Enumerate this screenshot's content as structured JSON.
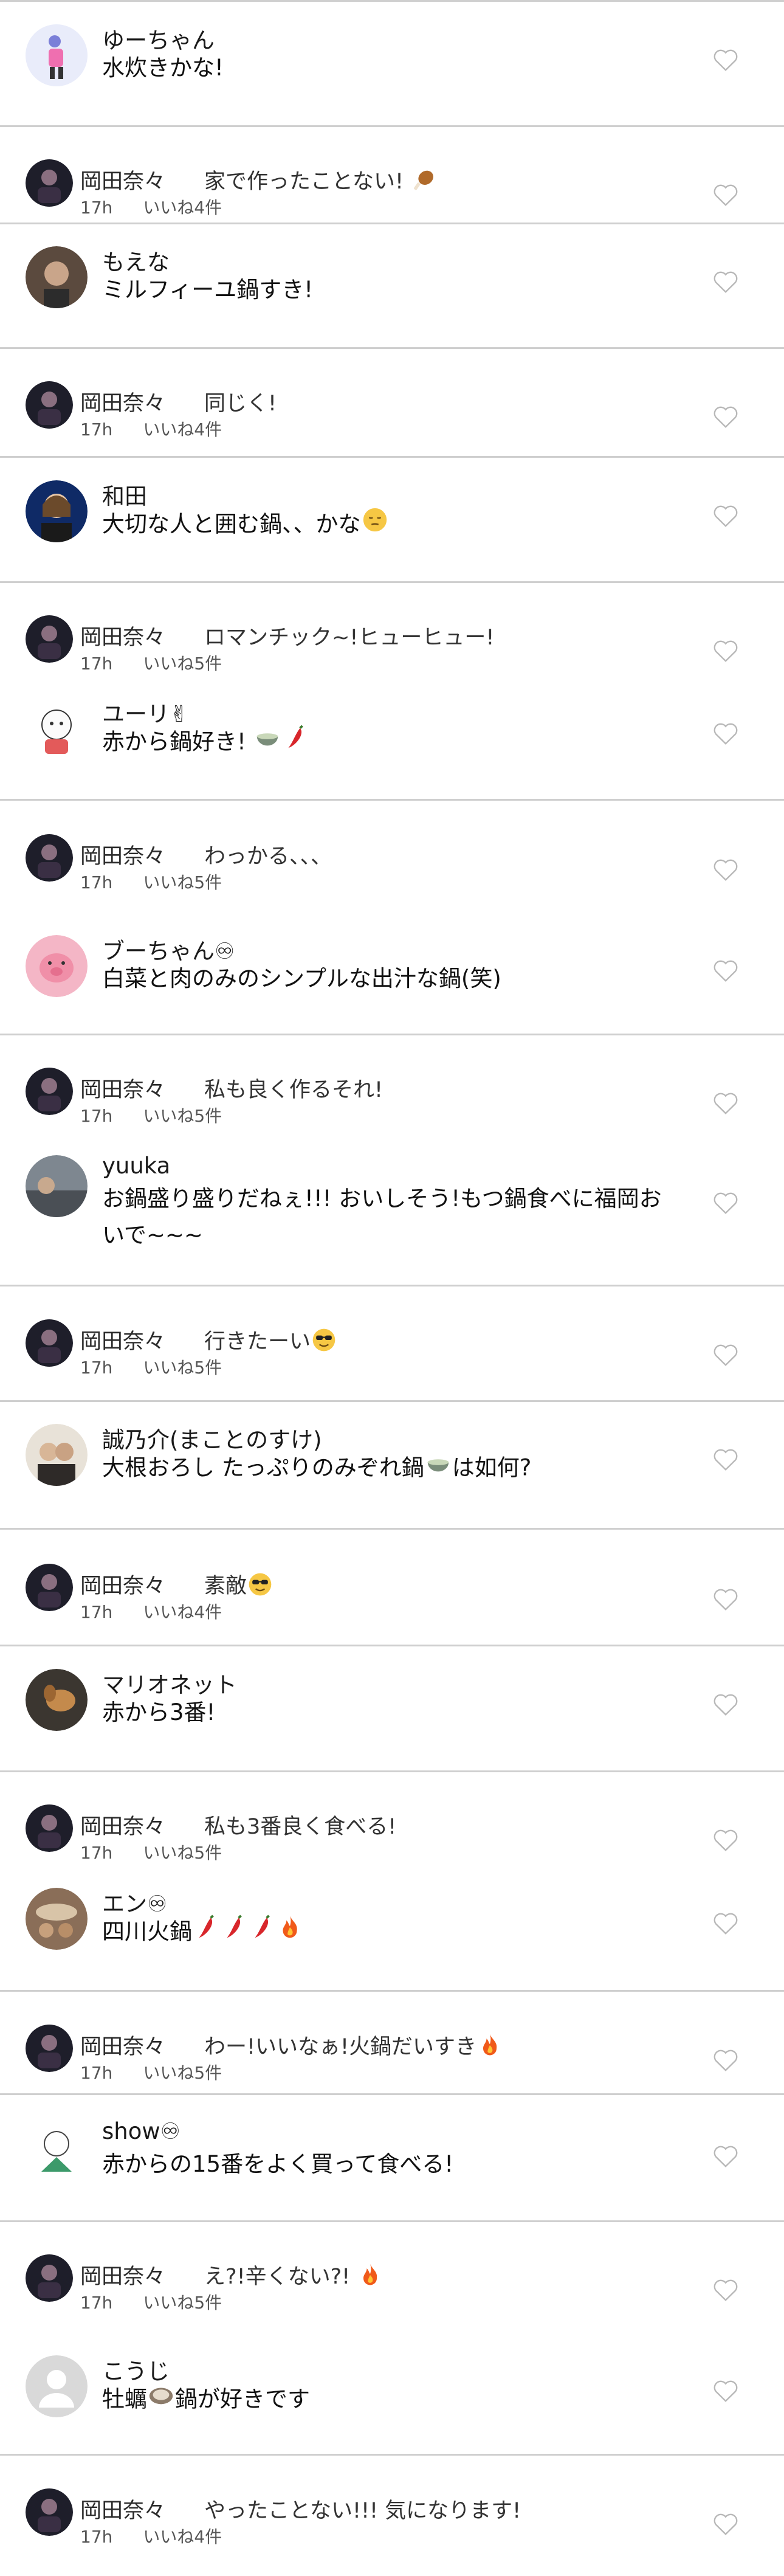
{
  "colors": {
    "divider": "#cfcfcf",
    "text": "#111111",
    "meta": "#555555",
    "heart_outline": "#b8b8b8"
  },
  "icons": {
    "like": "heart-outline-icon"
  },
  "comments": [
    {
      "user": "ゆーちゃん",
      "text": "水炊きかな!",
      "reply": {
        "user": "岡田奈々",
        "text": "家で作ったことない!",
        "time": "17h",
        "likes": "いいね4件"
      }
    },
    {
      "user": "もえな",
      "text": "ミルフィーユ鍋すき!",
      "reply": {
        "user": "岡田奈々",
        "text": "同じく!",
        "time": "17h",
        "likes": "いいね4件"
      }
    },
    {
      "user": "和田",
      "text": "大切な人と囲む鍋、、かな",
      "reply": {
        "user": "岡田奈々",
        "text": "ロマンチック~!ヒューヒュー!",
        "time": "17h",
        "likes": "いいね5件"
      }
    },
    {
      "user": "ユーリ✌",
      "text": "赤から鍋好き!",
      "reply": {
        "user": "岡田奈々",
        "text": "わっかる、、、",
        "time": "17h",
        "likes": "いいね5件"
      }
    },
    {
      "user": "ブーちゃん♾",
      "text": "白菜と肉のみのシンプルな出汁な鍋(笑)",
      "reply": {
        "user": "岡田奈々",
        "text": "私も良く作るそれ!",
        "time": "17h",
        "likes": "いいね5件"
      }
    },
    {
      "user": "yuuka",
      "text": "お鍋盛り盛りだねぇ!!! おいしそう!もつ鍋食べに福岡おいで~~~",
      "reply": {
        "user": "岡田奈々",
        "text": "行きたーい",
        "time": "17h",
        "likes": "いいね5件"
      }
    },
    {
      "user": "誠乃介(まことのすけ)",
      "text": "大根おろし たっぷりのみぞれ鍋",
      "text_b": "は如何?",
      "reply": {
        "user": "岡田奈々",
        "text": "素敵",
        "time": "17h",
        "likes": "いいね4件"
      }
    },
    {
      "user": "マリオネット",
      "text": "赤から3番!",
      "reply": {
        "user": "岡田奈々",
        "text": "私も3番良く食べる!",
        "time": "17h",
        "likes": "いいね5件"
      }
    },
    {
      "user": "エン♾",
      "text": "四川火鍋",
      "reply": {
        "user": "岡田奈々",
        "text": "わー!いいなぁ!火鍋だいすき",
        "time": "17h",
        "likes": "いいね5件"
      }
    },
    {
      "user": "show♾",
      "text": "赤からの15番をよく買って食べる!",
      "reply": {
        "user": "岡田奈々",
        "text": "え?!辛くない?!",
        "time": "17h",
        "likes": "いいね5件"
      }
    },
    {
      "user": "こうじ",
      "text": "牡蠣",
      "text_b": "鍋が好きです",
      "reply": {
        "user": "岡田奈々",
        "text": "やったことない!!! 気になります!",
        "time": "17h",
        "likes": "いいね4件"
      }
    }
  ]
}
